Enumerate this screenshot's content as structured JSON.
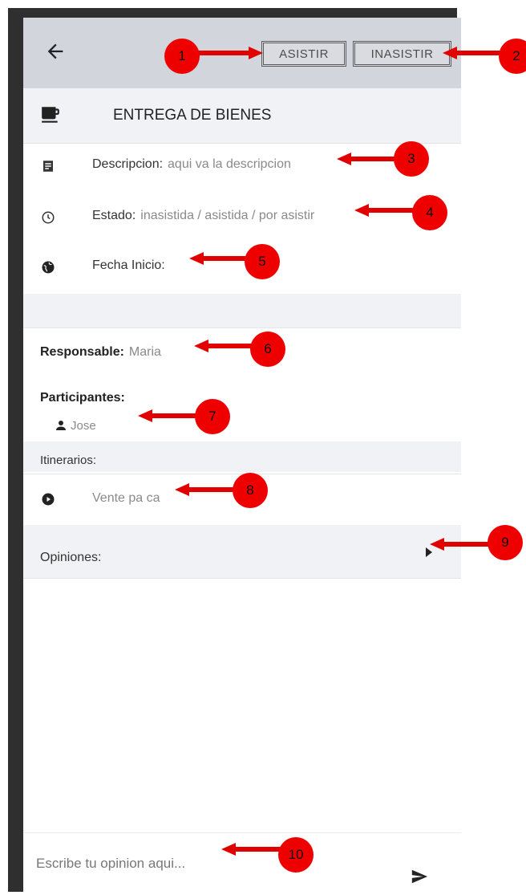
{
  "header": {
    "back_icon": "arrow-left-icon",
    "asistir_label": "ASISTIR",
    "inasistir_label": "INASISTIR"
  },
  "event": {
    "icon": "coffee-icon",
    "title": "ENTREGA DE BIENES"
  },
  "details": {
    "descripcion_label": "Descripcion:",
    "descripcion_value": "aqui va la descripcion",
    "estado_label": "Estado:",
    "estado_value": "inasistida / asistida / por asistir",
    "fecha_label": "Fecha Inicio:"
  },
  "responsable": {
    "label": "Responsable:",
    "value": "Maria"
  },
  "participantes": {
    "label": "Participantes:",
    "items": [
      "Jose"
    ]
  },
  "itinerarios": {
    "label": "Itinerarios:",
    "items": [
      "Vente pa ca"
    ]
  },
  "opiniones": {
    "label": "Opiniones:"
  },
  "composer": {
    "placeholder": "Escribe tu opinion aqui..."
  },
  "annotations": [
    "1",
    "2",
    "3",
    "4",
    "5",
    "6",
    "7",
    "8",
    "9",
    "10"
  ],
  "colors": {
    "annotation": "#ee0000",
    "appbar": "#d3d5dc",
    "frame": "#2f2f2f"
  }
}
